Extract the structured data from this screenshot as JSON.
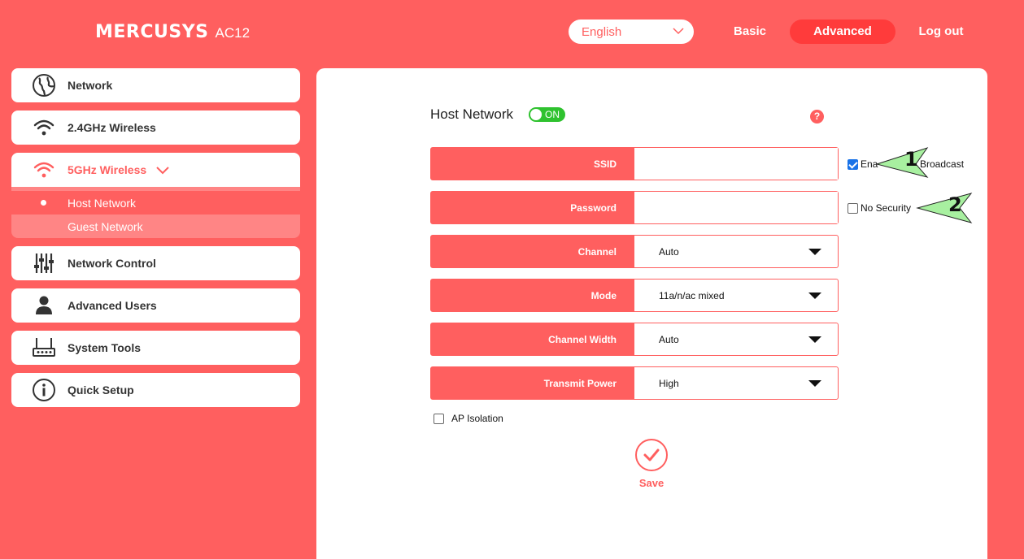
{
  "header": {
    "brand": "MERCUSYS",
    "model": "AC12",
    "language": "English",
    "nav": {
      "basic": "Basic",
      "advanced": "Advanced",
      "logout": "Log out"
    }
  },
  "sidebar": {
    "items": [
      {
        "label": "Network",
        "icon": "globe-icon"
      },
      {
        "label": "2.4GHz Wireless",
        "icon": "wifi-icon"
      },
      {
        "label": "5GHz Wireless",
        "icon": "wifi-icon",
        "active": true
      },
      {
        "label": "Network Control",
        "icon": "sliders-icon"
      },
      {
        "label": "Advanced Users",
        "icon": "user-icon"
      },
      {
        "label": "System Tools",
        "icon": "router-icon"
      },
      {
        "label": "Quick Setup",
        "icon": "info-icon"
      }
    ],
    "sub_items": [
      {
        "label": "Host Network",
        "selected": true
      },
      {
        "label": "Guest Network"
      }
    ]
  },
  "main": {
    "title": "Host Network",
    "toggle": "ON",
    "help": "?",
    "fields": {
      "ssid": {
        "label": "SSID",
        "value": ""
      },
      "password": {
        "label": "Password",
        "value": ""
      },
      "channel": {
        "label": "Channel",
        "value": "Auto"
      },
      "mode": {
        "label": "Mode",
        "value": "11a/n/ac mixed"
      },
      "channel_width": {
        "label": "Channel Width",
        "value": "Auto"
      },
      "transmit_power": {
        "label": "Transmit Power",
        "value": "High"
      }
    },
    "enable_broadcast": {
      "label": "Enable SSID Broadcast",
      "label_visible_left": "Ena",
      "label_visible_right": "Broadcast",
      "checked": true
    },
    "no_security": {
      "label": "No Security",
      "checked": false
    },
    "ap_isolation": {
      "label": "AP Isolation",
      "checked": false
    },
    "save": "Save"
  },
  "callouts": {
    "one": "1",
    "two": "2"
  },
  "colors": {
    "accent": "#ff5f5f",
    "toggle_on": "#2fc22f",
    "callout": "#a8f0a0"
  }
}
